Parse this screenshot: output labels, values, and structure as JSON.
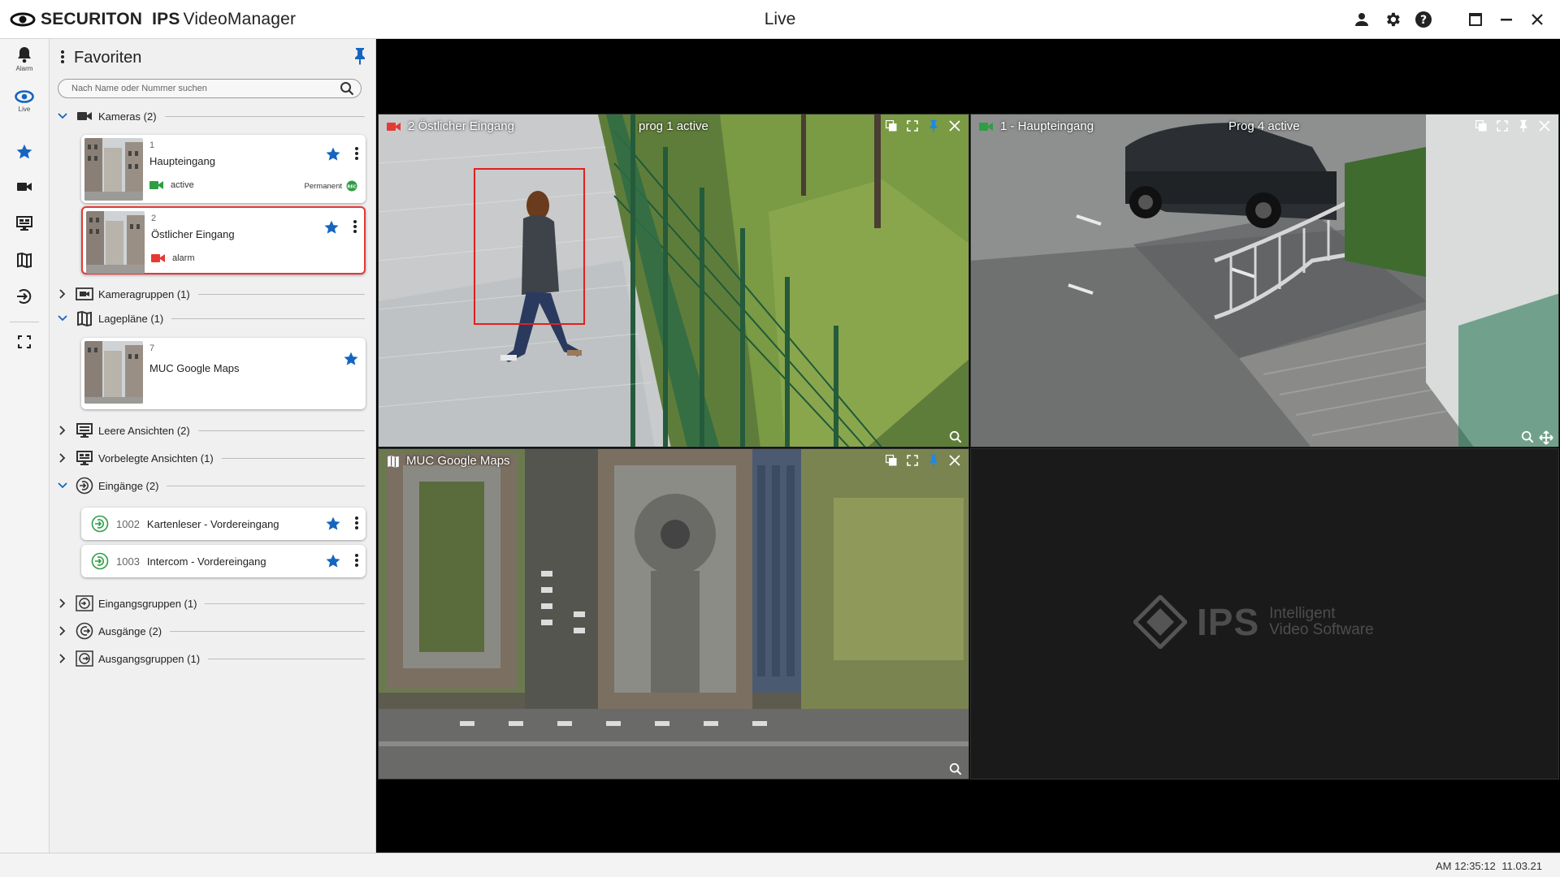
{
  "app": {
    "brand_company": "SECURITON",
    "brand_product_bold": "IPS",
    "brand_product": "VideoManager",
    "window_title": "Live"
  },
  "rail": {
    "items": [
      {
        "label": "Alarm",
        "icon": "bell-icon"
      },
      {
        "label": "Live",
        "icon": "eye-icon"
      },
      {
        "label": "",
        "icon": "star-icon"
      },
      {
        "label": "",
        "icon": "video-camera-icon"
      },
      {
        "label": "",
        "icon": "monitor-icon"
      },
      {
        "label": "",
        "icon": "map-icon"
      },
      {
        "label": "",
        "icon": "login-icon"
      },
      {
        "label": "",
        "icon": "fullscreen-icon"
      }
    ]
  },
  "favorites": {
    "title": "Favoriten",
    "search_placeholder": "Nach Name oder Nummer suchen",
    "groups": {
      "kameras": "Kameras (2)",
      "kameragruppen": "Kameragruppen (1)",
      "lageplaene": "Lagepläne (1)",
      "leere": "Leere Ansichten  (2)",
      "vorbelegte": "Vorbelegte Ansichten  (1)",
      "eingaenge": "Eingänge (2)",
      "eingangsgruppen": "Eingangsgruppen (1)",
      "ausgaenge": "Ausgänge  (2)",
      "ausgangsgruppen": "Ausgangsgruppen (1)"
    },
    "cameras": [
      {
        "number": "1",
        "name": "Haupteingang",
        "status": "active",
        "recording": "Permanent",
        "status_color": "#2e9e44"
      },
      {
        "number": "2",
        "name": "Östlicher Eingang",
        "status": "alarm",
        "status_color": "#e53935"
      }
    ],
    "maps": [
      {
        "number": "7",
        "name": "MUC Google Maps"
      }
    ],
    "inputs": [
      {
        "number": "1002",
        "name": "Kartenleser - Vordereingang"
      },
      {
        "number": "1003",
        "name": "Intercom - Vordereingang"
      }
    ]
  },
  "video": {
    "tiles": [
      {
        "title": "2 Östlicher Eingang",
        "overlay": "prog 1 active",
        "indicator_color": "#e53935"
      },
      {
        "title": "1 - Haupteingang",
        "overlay": "Prog 4 active",
        "indicator_color": "#2e9e44"
      },
      {
        "title": "MUC Google Maps",
        "overlay": ""
      }
    ],
    "placeholder_logo": {
      "text": "IPS",
      "line1": "Intelligent",
      "line2": "Video Software"
    }
  },
  "statusbar": {
    "time": "AM 12:35:12",
    "date": "11.03.21"
  },
  "colors": {
    "accent_blue": "#1565c0",
    "alarm_red": "#e53935",
    "active_green": "#2e9e44"
  }
}
